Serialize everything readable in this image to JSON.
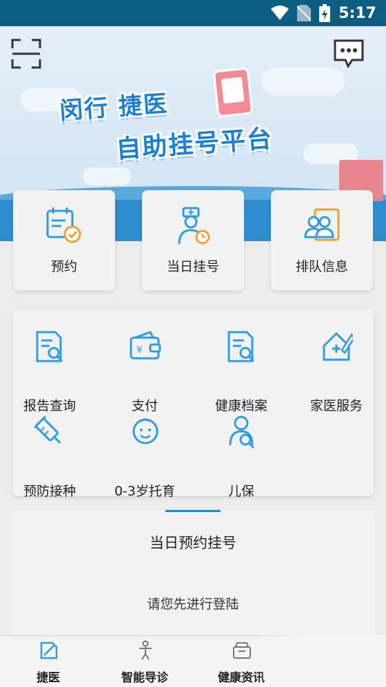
{
  "status_bar": {
    "time": "5:17"
  },
  "banner": {
    "title_line1": "闵行 捷医",
    "title_line2": "自助挂号平台"
  },
  "quick_actions": [
    {
      "label": "预约",
      "icon": "calendar-check-icon"
    },
    {
      "label": "当日挂号",
      "icon": "doctor-clock-icon"
    },
    {
      "label": "排队信息",
      "icon": "people-queue-icon"
    }
  ],
  "services": [
    {
      "label": "报告查询",
      "icon": "report-search-icon"
    },
    {
      "label": "支付",
      "icon": "wallet-icon"
    },
    {
      "label": "健康档案",
      "icon": "health-record-icon"
    },
    {
      "label": "家医服务",
      "icon": "family-doctor-icon"
    },
    {
      "label": "预防接种",
      "icon": "syringe-icon"
    },
    {
      "label": "0-3岁托育",
      "icon": "baby-icon"
    },
    {
      "label": "儿保",
      "icon": "child-care-icon"
    }
  ],
  "reservation": {
    "title": "当日预约挂号",
    "message": "请您先进行登陆"
  },
  "tabs": [
    {
      "label": "捷医",
      "icon": "home-doc-icon"
    },
    {
      "label": "智能导诊",
      "icon": "body-guide-icon"
    },
    {
      "label": "健康资讯",
      "icon": "news-box-icon"
    }
  ],
  "colors": {
    "accent": "#2f9be6",
    "status_bar": "#0b5d82",
    "icon_orange": "#f0a030"
  }
}
